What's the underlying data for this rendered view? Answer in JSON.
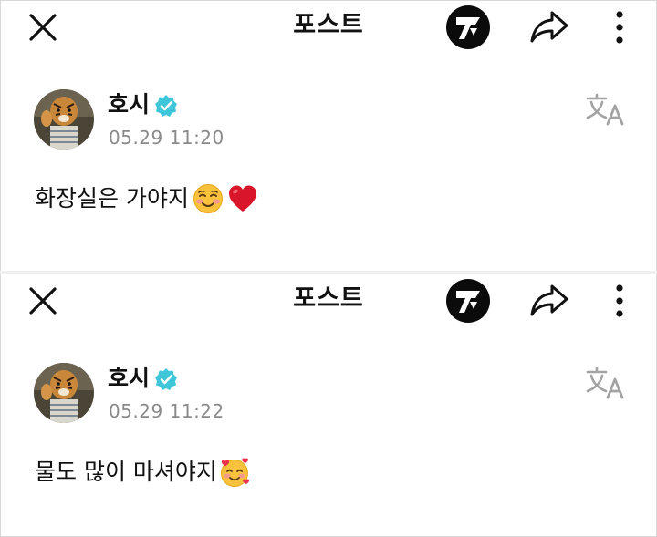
{
  "posts": [
    {
      "header": {
        "title": "포스트",
        "close_icon": "close-icon",
        "brand_icon": "seventeen-logo-icon",
        "share_icon": "share-icon",
        "more_icon": "more-vertical-icon"
      },
      "author": {
        "name": "호시",
        "verified": true,
        "verified_color": "#3fc6d9"
      },
      "timestamp": "05.29 11:20",
      "translate_icon": "translate-icon",
      "text": "화장실은 가야지",
      "emojis": [
        "smiling-face-icon",
        "red-heart-icon"
      ]
    },
    {
      "header": {
        "title": "포스트",
        "close_icon": "close-icon",
        "brand_icon": "seventeen-logo-icon",
        "share_icon": "share-icon",
        "more_icon": "more-vertical-icon"
      },
      "author": {
        "name": "호시",
        "verified": true,
        "verified_color": "#3fc6d9"
      },
      "timestamp": "05.29 11:22",
      "translate_icon": "translate-icon",
      "text": "물도 많이 마셔야지",
      "emojis": [
        "smiling-face-with-hearts-icon"
      ]
    }
  ]
}
